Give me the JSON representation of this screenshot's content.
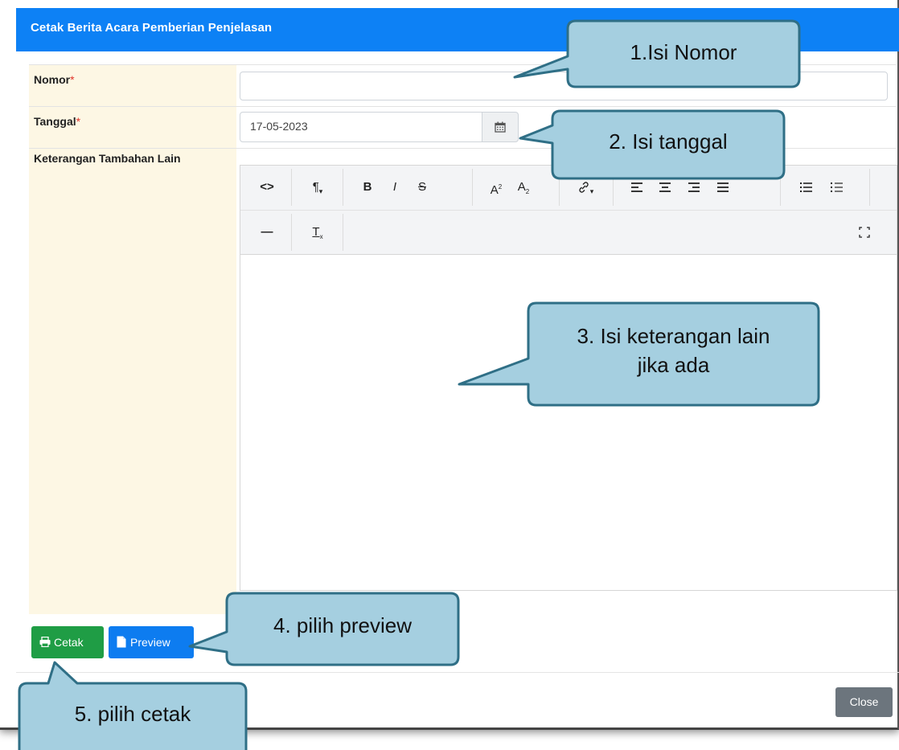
{
  "modal": {
    "title": "Cetak Berita Acara Pemberian Penjelasan"
  },
  "form": {
    "nomor_label": "Nomor",
    "tanggal_label": "Tanggal",
    "keterangan_label": "Keterangan Tambahan Lain",
    "required_mark": "*",
    "nomor_value": "",
    "tanggal_value": "17-05-2023"
  },
  "editor": {
    "toolbar_icons": [
      "code-view",
      "paragraph",
      "bold",
      "italic",
      "strikethrough",
      "superscript",
      "subscript",
      "link",
      "align-left",
      "align-center",
      "align-right",
      "align-justify",
      "unordered-list",
      "ordered-list",
      "horizontal-rule",
      "clear-formatting",
      "fullscreen"
    ]
  },
  "buttons": {
    "cetak_label": "Cetak",
    "preview_label": "Preview",
    "close_label": "Close"
  },
  "callouts": {
    "c1": "1.Isi Nomor",
    "c2": "2. Isi tanggal",
    "c3_line1": "3. Isi keterangan lain",
    "c3_line2": "jika ada",
    "c4": "4. pilih preview",
    "c5": "5. pilih cetak"
  },
  "colors": {
    "header": "#0d81f5",
    "label_bg": "#fdf7e4",
    "cetak": "#1f9d45",
    "preview": "#0d7cf0",
    "close": "#6c757d",
    "callout_fill": "#a5cfe0",
    "callout_border": "#2f6f86"
  }
}
